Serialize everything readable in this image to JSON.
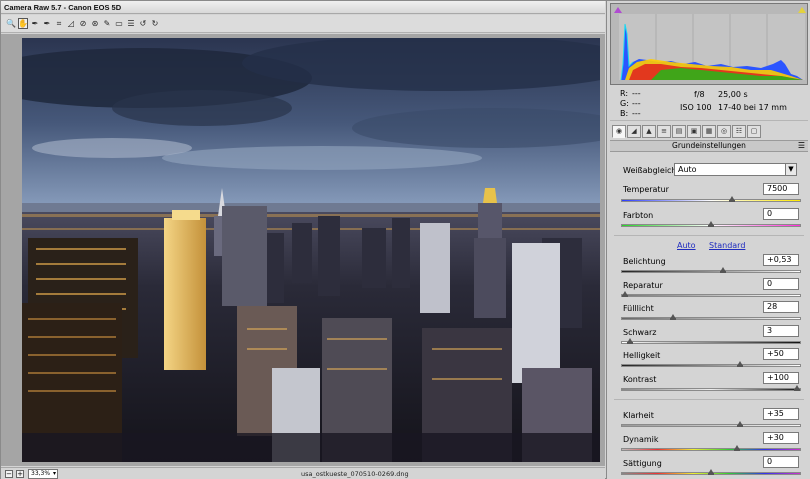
{
  "window": {
    "title": "Camera Raw 5.7 - Canon EOS 5D"
  },
  "toolbar": {
    "tools": [
      {
        "name": "zoom-tool-icon",
        "glyph": "🔍"
      },
      {
        "name": "hand-tool-icon",
        "glyph": "✋"
      },
      {
        "name": "white-balance-tool-icon",
        "glyph": "✒"
      },
      {
        "name": "color-sampler-tool-icon",
        "glyph": "✒"
      },
      {
        "name": "crop-tool-icon",
        "glyph": "⌗"
      },
      {
        "name": "straighten-tool-icon",
        "glyph": "◿"
      },
      {
        "name": "spot-removal-tool-icon",
        "glyph": "⊘"
      },
      {
        "name": "red-eye-tool-icon",
        "glyph": "⊛"
      },
      {
        "name": "adjustment-brush-icon",
        "glyph": "✎"
      },
      {
        "name": "graduated-filter-icon",
        "glyph": "▭"
      },
      {
        "name": "preferences-icon",
        "glyph": "☰"
      },
      {
        "name": "rotate-left-icon",
        "glyph": "↺"
      },
      {
        "name": "rotate-right-icon",
        "glyph": "↻"
      }
    ]
  },
  "status": {
    "zoom_out": "−",
    "zoom_in": "+",
    "zoom_level": "33,3%",
    "filename": "usa_ostkueste_070510-0269.dng"
  },
  "readout": {
    "r_label": "R:",
    "r_value": "---",
    "g_label": "G:",
    "g_value": "---",
    "b_label": "B:",
    "b_value": "---",
    "aperture": "f/8",
    "shutter": "25,00 s",
    "iso": "ISO 100",
    "lens": "17-40 bei 17 mm"
  },
  "panel": {
    "section_title": "Grundeinstellungen",
    "white_balance_label": "Weißabgleich:",
    "white_balance_value": "Auto",
    "auto_link": "Auto",
    "standard_link": "Standard",
    "sliders": [
      {
        "label": "Temperatur",
        "value": "7500",
        "level": 0.62
      },
      {
        "label": "Farbton",
        "value": "0",
        "level": 0.5
      },
      {
        "label": "Belichtung",
        "value": "+0,53",
        "level": 0.57
      },
      {
        "label": "Reparatur",
        "value": "0",
        "level": 0.0
      },
      {
        "label": "Fülllicht",
        "value": "28",
        "level": 0.28
      },
      {
        "label": "Schwarz",
        "value": "3",
        "level": 0.03
      },
      {
        "label": "Helligkeit",
        "value": "+50",
        "level": 0.67
      },
      {
        "label": "Kontrast",
        "value": "+100",
        "level": 1.0
      },
      {
        "label": "Klarheit",
        "value": "+35",
        "level": 0.67
      },
      {
        "label": "Dynamik",
        "value": "+30",
        "level": 0.65
      },
      {
        "label": "Sättigung",
        "value": "0",
        "level": 0.5
      }
    ]
  },
  "colors": {
    "accent_link": "#1e2bbf",
    "panel_bg": "#d4d4d4",
    "viewport_bg": "#a5a5a5"
  }
}
